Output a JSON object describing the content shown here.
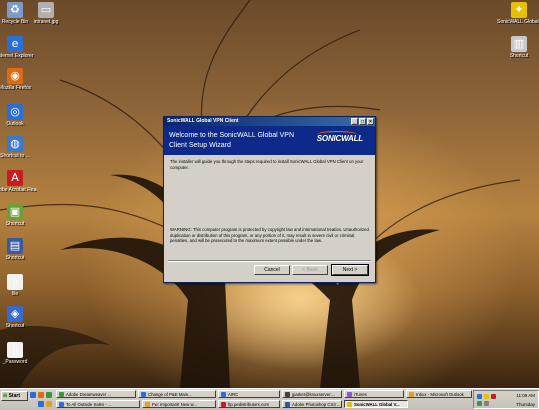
{
  "desktop": {
    "icons": [
      {
        "label": "Recycle Bin",
        "color": "#7a9cc8",
        "glyph": "♻"
      },
      {
        "label": "intranet.jpg",
        "color": "#b0b0b0",
        "glyph": "▭"
      },
      {
        "label": "Internet Explorer",
        "color": "#2a6fd6",
        "glyph": "e"
      },
      {
        "label": "Mozilla Firefox",
        "color": "#e06a10",
        "glyph": "◉"
      },
      {
        "label": "Outlook",
        "color": "#2a6fd6",
        "glyph": "◎"
      },
      {
        "label": "Shortcut to ...",
        "color": "#3a7acc",
        "glyph": "◍"
      },
      {
        "label": "Adobe Acrobat Reader",
        "color": "#c41e1e",
        "glyph": "A"
      },
      {
        "label": "Shortcut",
        "color": "#6aa03a",
        "glyph": "▣"
      },
      {
        "label": "Shortcut",
        "color": "#3a5aa0",
        "glyph": "▤"
      },
      {
        "label": "file",
        "color": "#f2f2f2",
        "glyph": "▯"
      },
      {
        "label": "Shortcut",
        "color": "#3a6ad0",
        "glyph": "◈"
      },
      {
        "label": "_Password",
        "color": "#f2f2f2",
        "glyph": "▯"
      },
      {
        "label": "SonicWALL Global VPN Client",
        "color": "#e8c000",
        "glyph": "✦"
      },
      {
        "label": "Shortcut",
        "color": "#c8c8c8",
        "glyph": "▥"
      }
    ]
  },
  "dialog": {
    "window_title": "SonicWALL Global VPN Client",
    "heading_line1": "Welcome to the SonicWALL Global VPN",
    "heading_line2": "Client Setup Wizard",
    "logo": "SONICWALL",
    "intro": "The installer will guide you through the steps required to install SonicWALL Global VPN Client on your computer.",
    "warning": "WARNING: This computer program is protected by copyright law and international treaties. Unauthorized duplication or distribution of this program, or any portion of it, may result in severe civil or criminal penalties, and will be prosecuted to the maximum extent possible under the law.",
    "buttons": {
      "cancel": "Cancel",
      "back": "< Back",
      "next": "Next >"
    }
  },
  "taskbar": {
    "start": "Start",
    "row1": [
      {
        "label": "Adobe Dreamweaver ...",
        "color": "#3a9a3a"
      },
      {
        "label": "Change of P&E Main...",
        "color": "#2a6fd6"
      },
      {
        "label": "AIRC",
        "color": "#2a6fd6"
      },
      {
        "label": "jparker@knuxserver:...",
        "color": "#404040"
      },
      {
        "label": "iTunes",
        "color": "#8a5ad0"
      },
      {
        "label": "Inbox - Microsoft Outlook",
        "color": "#e0a020"
      }
    ],
    "row2": [
      {
        "label": "To All Outside Sales - ...",
        "color": "#2a6fd6"
      },
      {
        "label": "Fw: Important! New w...",
        "color": "#e0a020"
      },
      {
        "label": "ftp.pedistributors.com",
        "color": "#c41e1e"
      },
      {
        "label": "Adobe Photoshop CS3 ...",
        "color": "#2a5aa0"
      },
      {
        "label": "SonicWALL Global V...",
        "color": "#e8c000",
        "active": true
      }
    ],
    "clock": {
      "time": "11:09 AM",
      "day": "Thursday"
    }
  }
}
